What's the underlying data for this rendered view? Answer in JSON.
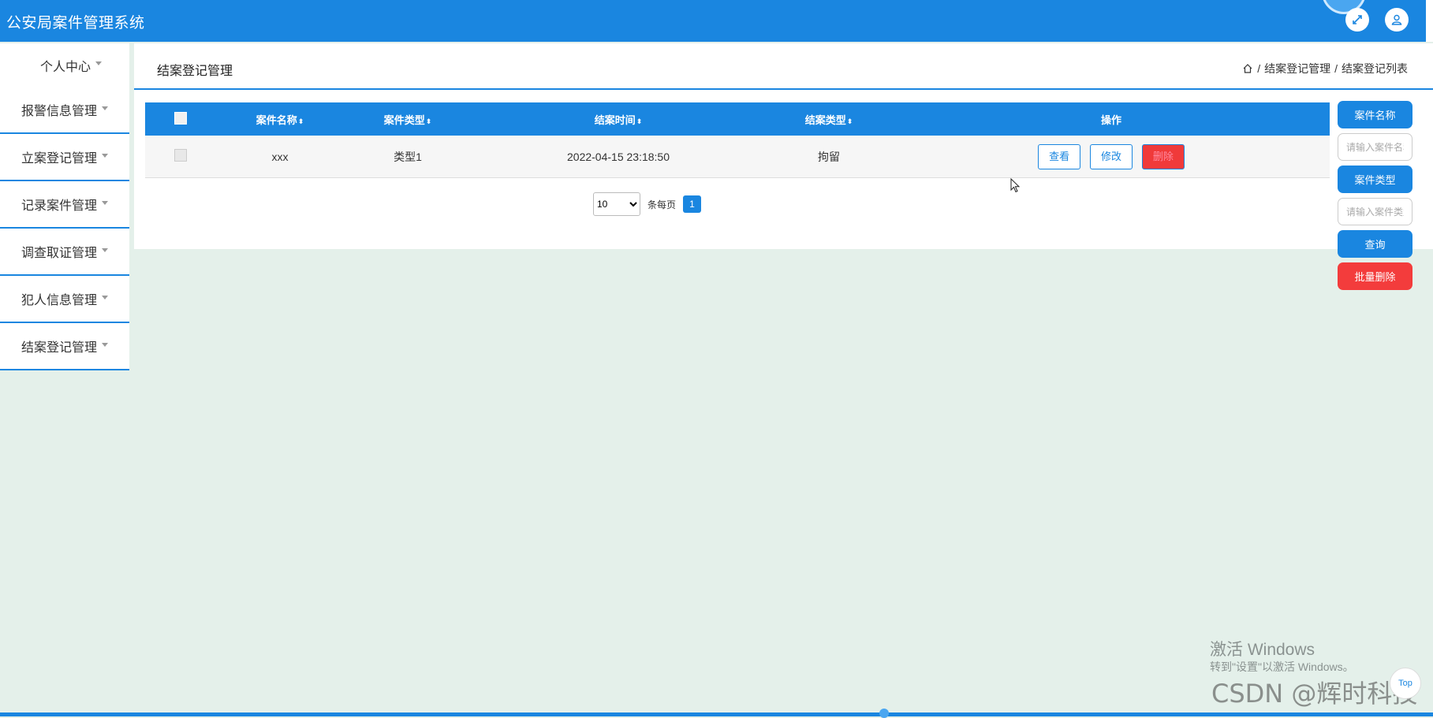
{
  "app": {
    "title": "公安局案件管理系统"
  },
  "header": {
    "icons": [
      "expand-icon",
      "user-icon"
    ]
  },
  "sidebar": {
    "items": [
      {
        "label": "个人中心"
      },
      {
        "label": "报警信息管理"
      },
      {
        "label": "立案登记管理"
      },
      {
        "label": "记录案件管理"
      },
      {
        "label": "调查取证管理"
      },
      {
        "label": "犯人信息管理"
      },
      {
        "label": "结案登记管理"
      }
    ]
  },
  "page": {
    "title": "结案登记管理",
    "breadcrumb": {
      "sep1": "/",
      "level1": "结案登记管理",
      "sep2": "/",
      "level2": "结案登记列表"
    }
  },
  "table": {
    "columns": [
      "案件名称",
      "案件类型",
      "结案时间",
      "结案类型",
      "操作"
    ],
    "sort_icon": "⬍",
    "rows": [
      {
        "case_name": "xxx",
        "case_type": "类型1",
        "close_time": "2022-04-15 23:18:50",
        "close_type": "拘留"
      }
    ],
    "actions": {
      "view": "查看",
      "edit": "修改",
      "delete": "删除"
    }
  },
  "pagination": {
    "page_size": "10",
    "per_page_label": "条每页",
    "current_page": "1"
  },
  "search": {
    "name_label": "案件名称",
    "name_placeholder": "请输入案件名称",
    "type_label": "案件类型",
    "type_placeholder": "请输入案件类型",
    "query_button": "查询",
    "batch_delete_button": "批量删除"
  },
  "overlay": {
    "activate_title": "激活 Windows",
    "activate_sub": "转到\"设置\"以激活 Windows。",
    "csdn": "CSDN @辉时科技",
    "to_top": "Top"
  },
  "colors": {
    "primary": "#1a86e0",
    "danger": "#f33c3c",
    "background": "#e4f0ea"
  }
}
